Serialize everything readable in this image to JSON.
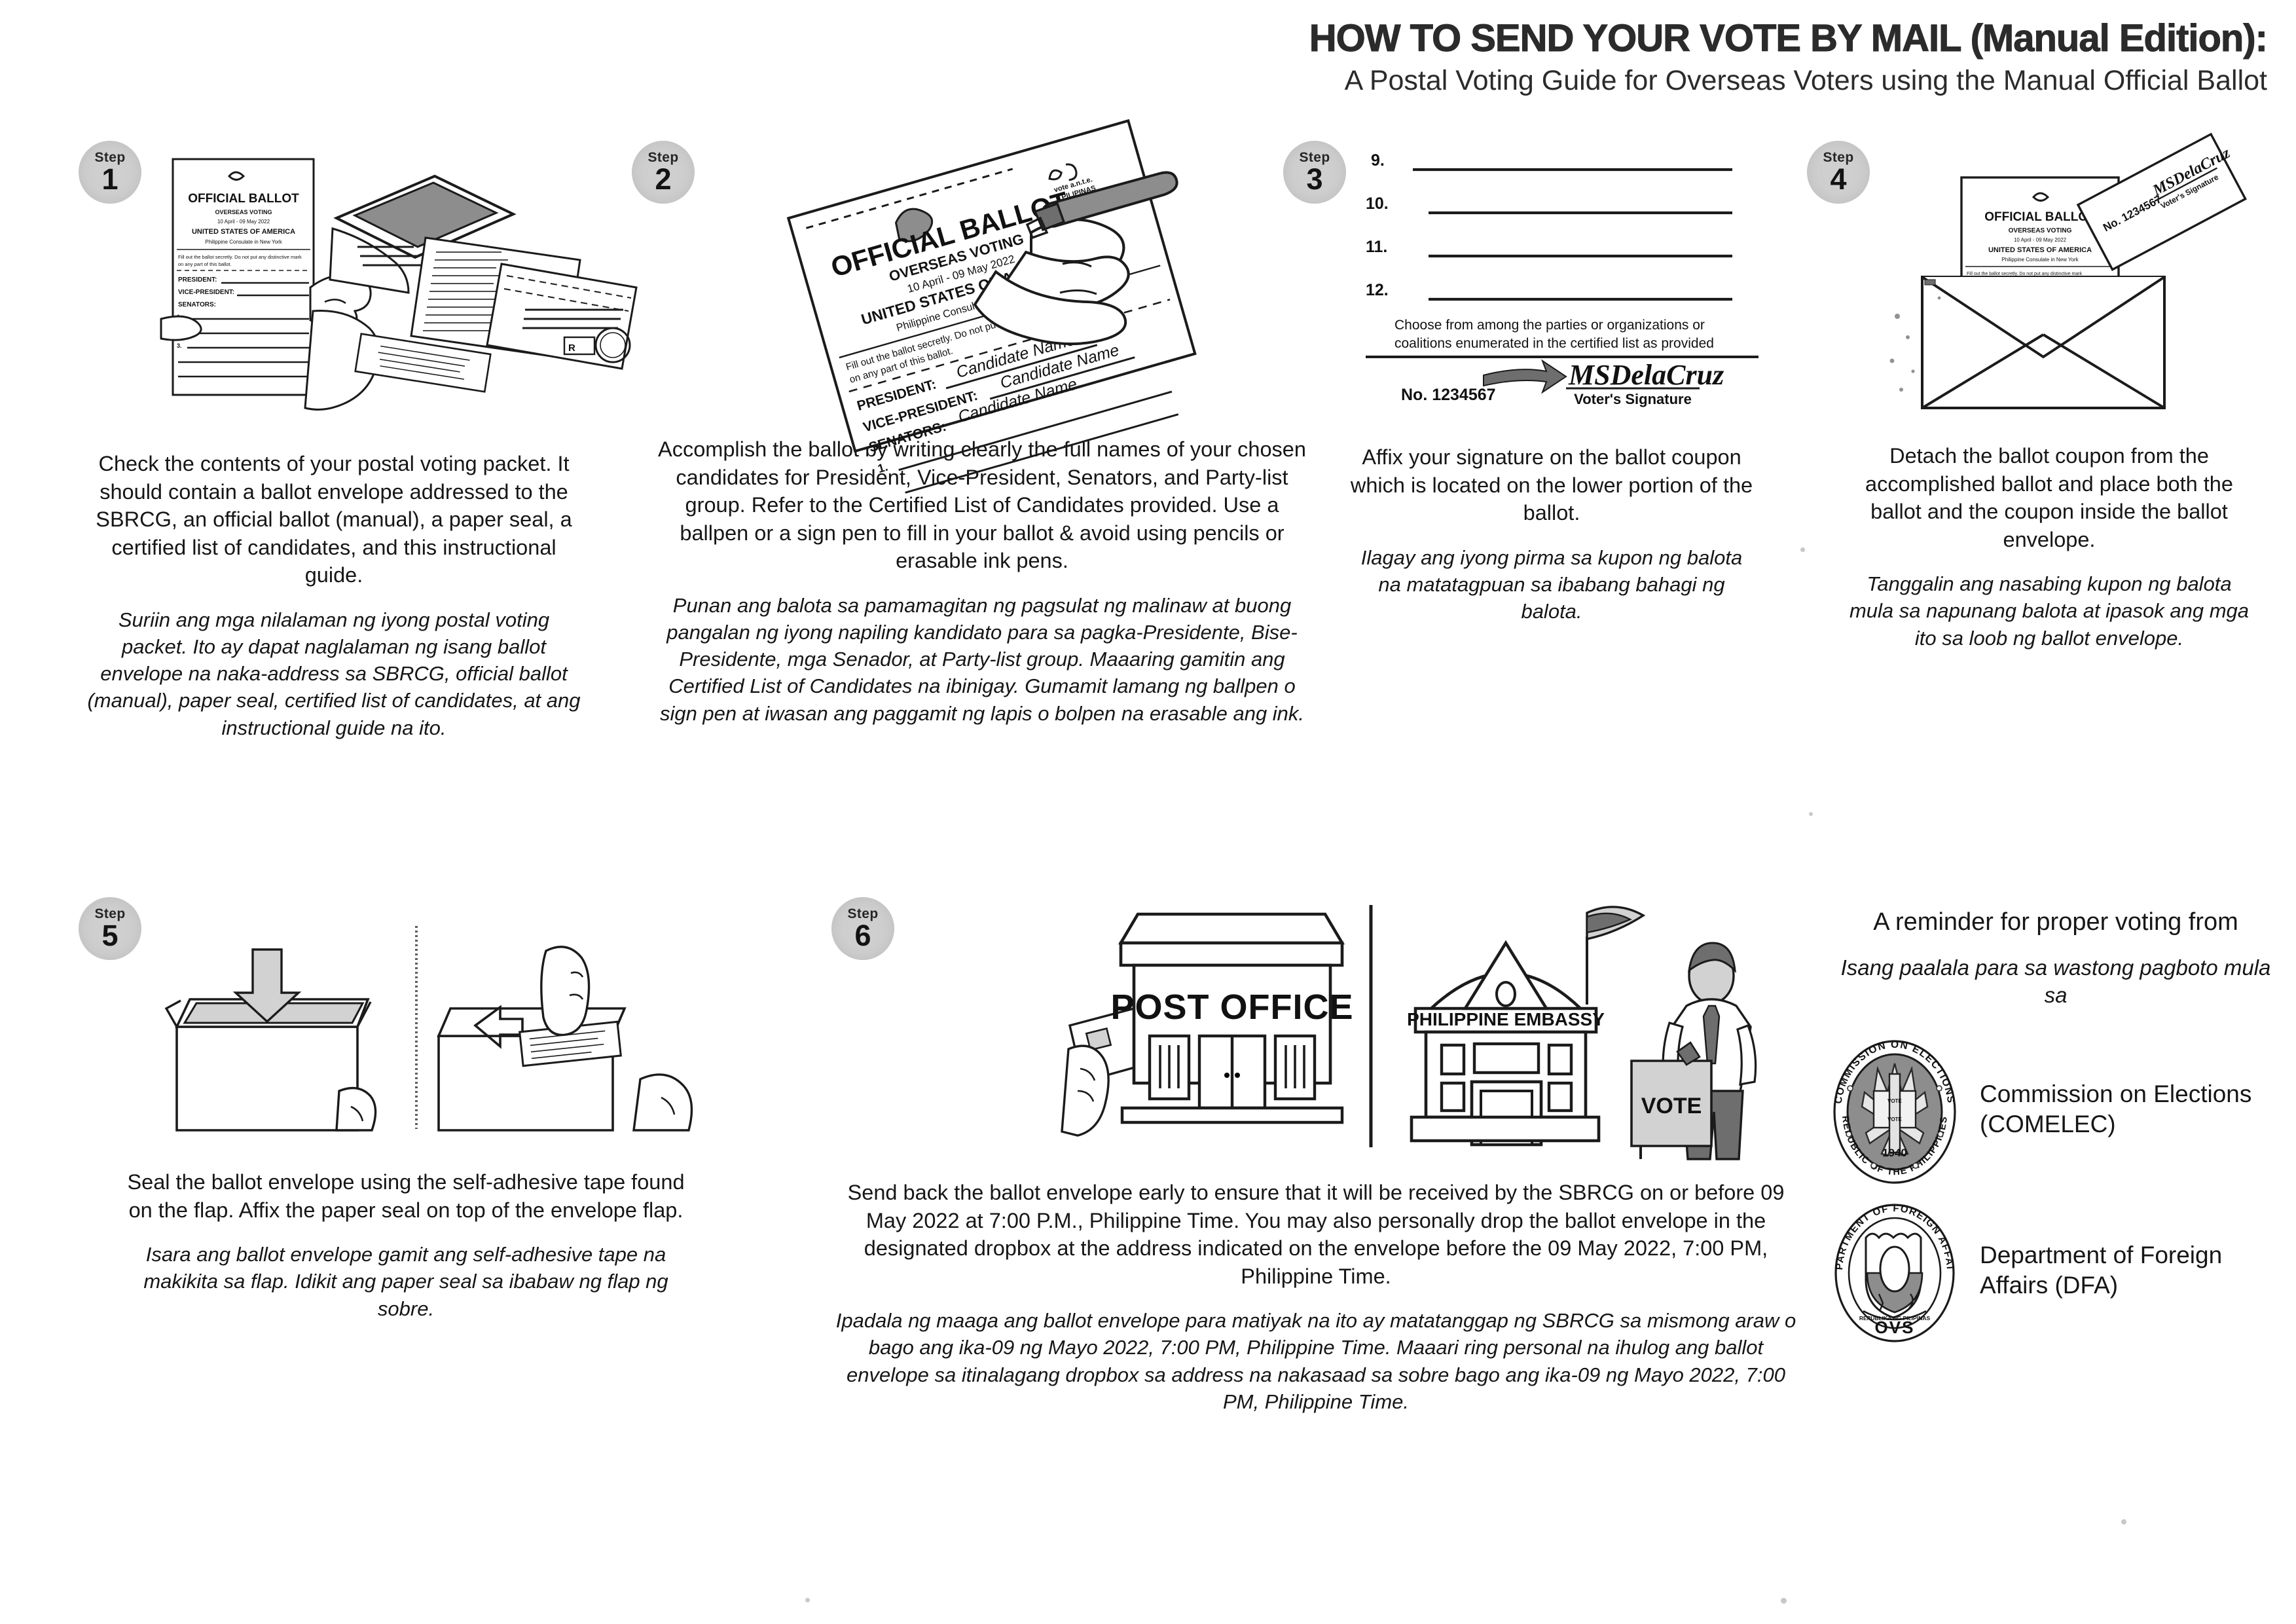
{
  "header": {
    "title": "HOW TO SEND YOUR VOTE BY MAIL (Manual Edition):",
    "subtitle": "A Postal Voting Guide for Overseas Voters using the Manual Official Ballot"
  },
  "badge_word": "Step",
  "steps": [
    {
      "number": "1",
      "english": "Check the contents of your postal voting packet. It should contain a ballot envelope addressed to the SBRCG, an official ballot (manual), a paper seal, a certified list of candidates, and this instructional guide.",
      "tagalog": "Suriin ang mga nilalaman ng iyong postal voting packet. Ito ay dapat naglalaman ng isang ballot envelope na naka-address sa SBRCG, official ballot (manual), paper seal, certified list of candidates, at ang instructional guide na ito."
    },
    {
      "number": "2",
      "english": "Accomplish the ballot by writing clearly the full names of your chosen candidates for President, Vice-President, Senators, and Party-list group. Refer to the Certified List of Candidates provided.  Use a ballpen or a sign pen to fill in your ballot & avoid using pencils or erasable ink pens.",
      "tagalog": "Punan ang balota sa pamamagitan ng pagsulat ng malinaw at buong pangalan ng iyong napiling kandidato para sa pagka-Presidente, Bise-Presidente, mga Senador, at Party-list group. Maaaring gamitin ang Certified List of Candidates na ibinigay. Gumamit lamang ng ballpen o sign pen at iwasan ang paggamit ng lapis o bolpen na erasable ang ink."
    },
    {
      "number": "3",
      "english": "Affix your signature on the ballot coupon which is located on the lower portion of the ballot.",
      "tagalog": "Ilagay ang iyong pirma sa kupon ng balota na matatagpuan sa ibabang bahagi ng balota."
    },
    {
      "number": "4",
      "english": "Detach the ballot coupon from the accomplished ballot and place both the ballot and the coupon inside the ballot envelope.",
      "tagalog": "Tanggalin ang nasabing kupon ng balota mula sa napunang balota at ipasok ang mga ito sa loob ng ballot envelope."
    },
    {
      "number": "5",
      "english": "Seal the ballot envelope using the self-adhesive tape found on the flap. Affix the paper seal on top of the envelope flap.",
      "tagalog": "Isara ang ballot envelope gamit ang self-adhesive tape na makikita sa flap. Idikit ang paper seal sa ibabaw ng flap ng sobre."
    },
    {
      "number": "6",
      "english": "Send back the ballot envelope early to ensure that it will be received by the SBRCG on or before 09 May 2022 at 7:00 P.M., Philippine Time.  You may also personally drop the ballot envelope in the designated dropbox at the address indicated on the envelope before the 09 May 2022, 7:00 PM, Philippine Time.",
      "tagalog": "Ipadala ng maaga ang ballot envelope para matiyak na ito ay matatanggap ng SBRCG sa mismong araw o bago ang ika-09 ng Mayo 2022, 7:00 PM, Philippine Time. Maaari ring personal na ihulog ang ballot envelope sa itinalagang dropbox sa address na nakasaad sa sobre bago ang ika-09 ng Mayo 2022, 7:00 PM, Philippine Time."
    }
  ],
  "reminder": {
    "heading": "A reminder for proper voting from",
    "heading_tagalog": "Isang paalala para sa wastong pagboto mula sa",
    "organizations": [
      {
        "name": "Commission on Elections (COMELEC)",
        "seal_outer_top": "COMMISSION ON ELECTIONS",
        "seal_outer_bottom": "REPUBLIC OF THE PHILIPPINES",
        "seal_year": "1940"
      },
      {
        "name": "Department of Foreign Affairs (DFA)",
        "seal_outer_top": "DEPARTMENT OF FOREIGN AFFAIRS",
        "seal_outer_bottom": "OVS",
        "seal_inner": "REPUBLIKA NG PILIPINAS"
      }
    ]
  },
  "illustrations": {
    "ballot": {
      "title": "OFFICIAL BALLOT",
      "line2": "OVERSEAS VOTING",
      "line3": "10 April - 09 May 2022",
      "line4": "UNITED STATES OF AMERICA",
      "line5": "Philippine Consulate in New York",
      "instruction": "Fill out the ballot secretly. Do not put any distinctive mark on any part of this ballot.",
      "logo_text": "vote a.n.t.e. PILIPINAS",
      "president_label": "PRESIDENT:",
      "vice_president_label": "VICE-PRESIDENT:",
      "senators_label": "SENATORS:",
      "candidate_placeholder": "Candidate Name"
    },
    "coupon": {
      "rows": [
        "9.",
        "10.",
        "11.",
        "12."
      ],
      "note": "Choose from among the parties or organizations or coalitions enumerated in the certified list as provided",
      "number": "No. 1234567",
      "signature": "MSDelaCruz",
      "signature_label": "Voter's Signature"
    },
    "buildings": {
      "post_office": "POST OFFICE",
      "embassy": "PHILIPPINE EMBASSY",
      "placard": "VOTE"
    }
  }
}
